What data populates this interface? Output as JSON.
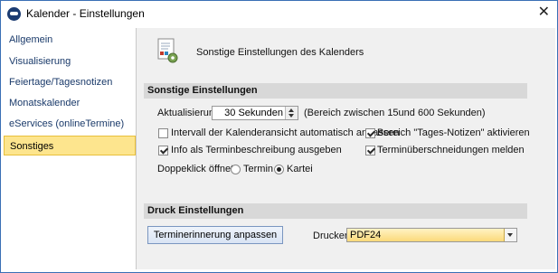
{
  "window": {
    "title": "Kalender - Einstellungen",
    "close_glyph": "✕"
  },
  "sidebar": {
    "items": [
      {
        "label": "Allgemein"
      },
      {
        "label": "Visualisierung"
      },
      {
        "label": "Feiertage/Tagesnotizen"
      },
      {
        "label": "Monatskalender"
      },
      {
        "label": "eServices (onlineTermine)"
      },
      {
        "label": "Sonstiges",
        "active": true
      }
    ]
  },
  "header": {
    "text": "Sonstige Einstellungen des Kalenders",
    "icon": "settings-document-icon"
  },
  "sonstige": {
    "section_title": "Sonstige Einstellungen",
    "aktualisierung_label": "Aktualisierung",
    "aktualisierung_value": "30 Sekunden",
    "aktualisierung_hint": "(Bereich zwischen 15und 600 Sekunden)",
    "cb_intervall": {
      "label": "Intervall der Kalenderansicht automatisch anpassen",
      "checked": false
    },
    "cb_tagesnotizen": {
      "label": "Bereich \"Tages-Notizen\" aktivieren",
      "checked": true
    },
    "cb_info": {
      "label": "Info als Terminbeschreibung ausgeben",
      "checked": true
    },
    "cb_ueberschneidungen": {
      "label": "Terminüberschneidungen melden",
      "checked": true
    },
    "doppelklick_label": "Doppeklick öffnet:",
    "radio_termin": {
      "label": "Termin",
      "checked": false
    },
    "radio_kartei": {
      "label": "Kartei",
      "checked": true
    }
  },
  "druck": {
    "section_title": "Druck Einstellungen",
    "button_label": "Terminerinnerung anpassen",
    "drucker_label": "Drucker",
    "drucker_value": "PDF24"
  }
}
